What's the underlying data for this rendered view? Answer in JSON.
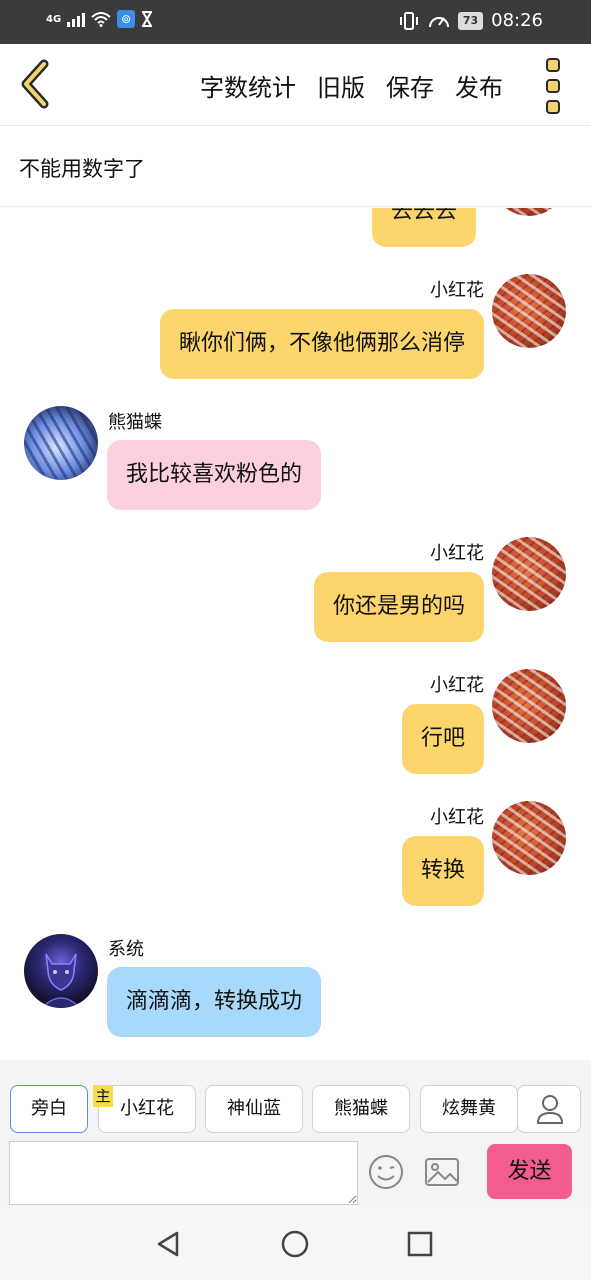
{
  "status_bar": {
    "network": "4G",
    "battery": "73",
    "time": "08:26"
  },
  "header": {
    "actions": [
      "字数统计",
      "旧版",
      "保存",
      "发布"
    ]
  },
  "title": "不能用数字了",
  "messages": [
    {
      "side": "right",
      "name": "",
      "text": "去去去",
      "color": "#fcd56c"
    },
    {
      "side": "right",
      "name": "小红花",
      "text": "瞅你们俩，不像他俩那么消停",
      "color": "#fcd56c"
    },
    {
      "side": "left",
      "name": "熊猫蝶",
      "text": "我比较喜欢粉色的",
      "color": "#fcd0dc"
    },
    {
      "side": "right",
      "name": "小红花",
      "text": "你还是男的吗",
      "color": "#fcd56c"
    },
    {
      "side": "right",
      "name": "小红花",
      "text": "行吧",
      "color": "#fcd56c"
    },
    {
      "side": "right",
      "name": "小红花",
      "text": "转换",
      "color": "#fcd56c"
    },
    {
      "side": "left",
      "name": "系统",
      "text": "滴滴滴，转换成功",
      "color": "#a8d9fa"
    }
  ],
  "roles": {
    "host_tag": "主",
    "items": [
      "旁白",
      "小红花",
      "神仙蓝",
      "熊猫蝶",
      "炫舞黄"
    ]
  },
  "input": {
    "value": "",
    "placeholder": ""
  },
  "send_label": "发送",
  "icons": {
    "back": "chevron-left-icon",
    "more": "more-vertical-icon",
    "emoji": "smiley-icon",
    "image": "image-icon",
    "user": "user-icon",
    "nav_back": "triangle-back-icon",
    "nav_home": "circle-home-icon",
    "nav_recent": "square-recent-icon"
  }
}
